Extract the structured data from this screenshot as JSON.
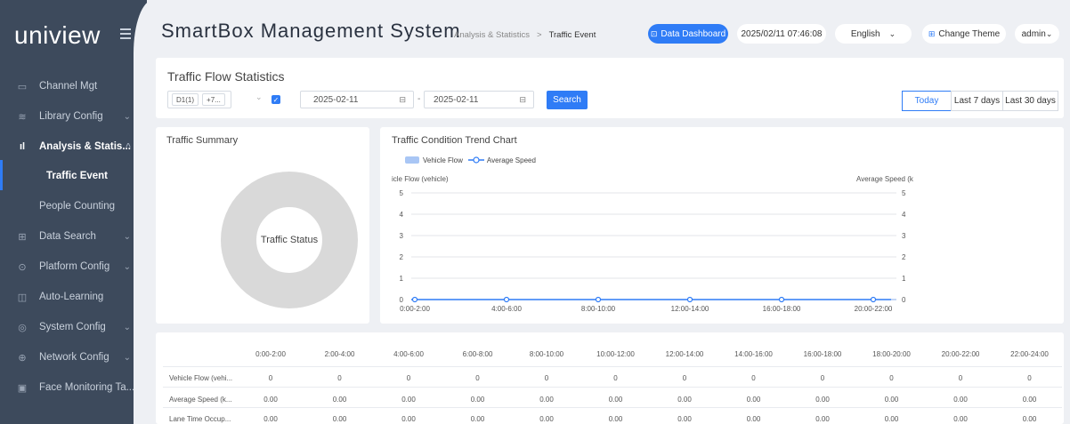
{
  "sidebar": {
    "logo": "uniview",
    "items": [
      {
        "label": "Channel Mgt",
        "icon": "channel-icon",
        "chevron": ""
      },
      {
        "label": "Library Config",
        "icon": "library-icon",
        "chevron": "⌄"
      },
      {
        "label": "Analysis & Statis...",
        "icon": "chart-icon",
        "chevron": "^"
      },
      {
        "label": "Data Search",
        "icon": "search-data-icon",
        "chevron": "⌄"
      },
      {
        "label": "Platform Config",
        "icon": "platform-icon",
        "chevron": "⌄"
      },
      {
        "label": "Auto-Learning",
        "icon": "book-icon",
        "chevron": ""
      },
      {
        "label": "System Config",
        "icon": "settings-icon",
        "chevron": "⌄"
      },
      {
        "label": "Network Config",
        "icon": "globe-icon",
        "chevron": "⌄"
      },
      {
        "label": "Face Monitoring Ta...",
        "icon": "monitor-icon",
        "chevron": ""
      }
    ],
    "sub_items": [
      {
        "label": "Traffic Event"
      },
      {
        "label": "People Counting"
      }
    ]
  },
  "header": {
    "title": "SmartBox Management System",
    "breadcrumb": [
      "Analysis & Statistics",
      ">",
      "Traffic Event"
    ],
    "data_dashboard": "Data Dashboard",
    "datetime": "2025/02/11 07:46:08",
    "language": "English",
    "change_theme": "Change Theme",
    "user": "admin"
  },
  "filters": {
    "title": "Traffic Flow Statistics",
    "tag1": "D1(1)",
    "tag2": "+7...",
    "start_date": "2025-02-11",
    "separator": "-",
    "end_date": "2025-02-11",
    "search_label": "Search",
    "range_today": "Today",
    "range_7": "Last 7 days",
    "range_30": "Last 30 days"
  },
  "summary": {
    "title": "Traffic Summary",
    "donut_label": "Traffic Status"
  },
  "trend": {
    "title": "Traffic Condition Trend Chart",
    "legend_flow": "Vehicle Flow",
    "legend_speed": "Average Speed",
    "left_axis_label": "icle Flow (vehicle)",
    "right_axis_label": "Average Speed (k"
  },
  "chart_data": {
    "type": "line",
    "categories": [
      "0:00-2:00",
      "4:00-6:00",
      "8:00-10:00",
      "12:00-14:00",
      "16:00-18:00",
      "20:00-22:00"
    ],
    "series": [
      {
        "name": "Vehicle Flow",
        "values": [
          0,
          0,
          0,
          0,
          0,
          0
        ]
      },
      {
        "name": "Average Speed",
        "values": [
          0,
          0,
          0,
          0,
          0,
          0
        ]
      }
    ],
    "ylim": [
      0,
      5
    ],
    "yticks": [
      "0",
      "1",
      "2",
      "3",
      "4",
      "5"
    ],
    "grid": true,
    "legend": "top-left"
  },
  "table": {
    "headers": [
      "0:00-2:00",
      "2:00-4:00",
      "4:00-6:00",
      "6:00-8:00",
      "8:00-10:00",
      "10:00-12:00",
      "12:00-14:00",
      "14:00-16:00",
      "16:00-18:00",
      "18:00-20:00",
      "20:00-22:00",
      "22:00-24:00"
    ],
    "rows": [
      {
        "label": "Vehicle Flow (vehi...",
        "values": [
          "0",
          "0",
          "0",
          "0",
          "0",
          "0",
          "0",
          "0",
          "0",
          "0",
          "0",
          "0"
        ]
      },
      {
        "label": "Average Speed (k...",
        "values": [
          "0.00",
          "0.00",
          "0.00",
          "0.00",
          "0.00",
          "0.00",
          "0.00",
          "0.00",
          "0.00",
          "0.00",
          "0.00",
          "0.00"
        ]
      },
      {
        "label": "Lane Time Occup...",
        "values": [
          "0.00",
          "0.00",
          "0.00",
          "0.00",
          "0.00",
          "0.00",
          "0.00",
          "0.00",
          "0.00",
          "0.00",
          "0.00",
          "0.00"
        ]
      }
    ]
  },
  "colors": {
    "sidebar": "#3d4a5c",
    "accent": "#2f7cf6",
    "donut": "#d9d9d9"
  }
}
